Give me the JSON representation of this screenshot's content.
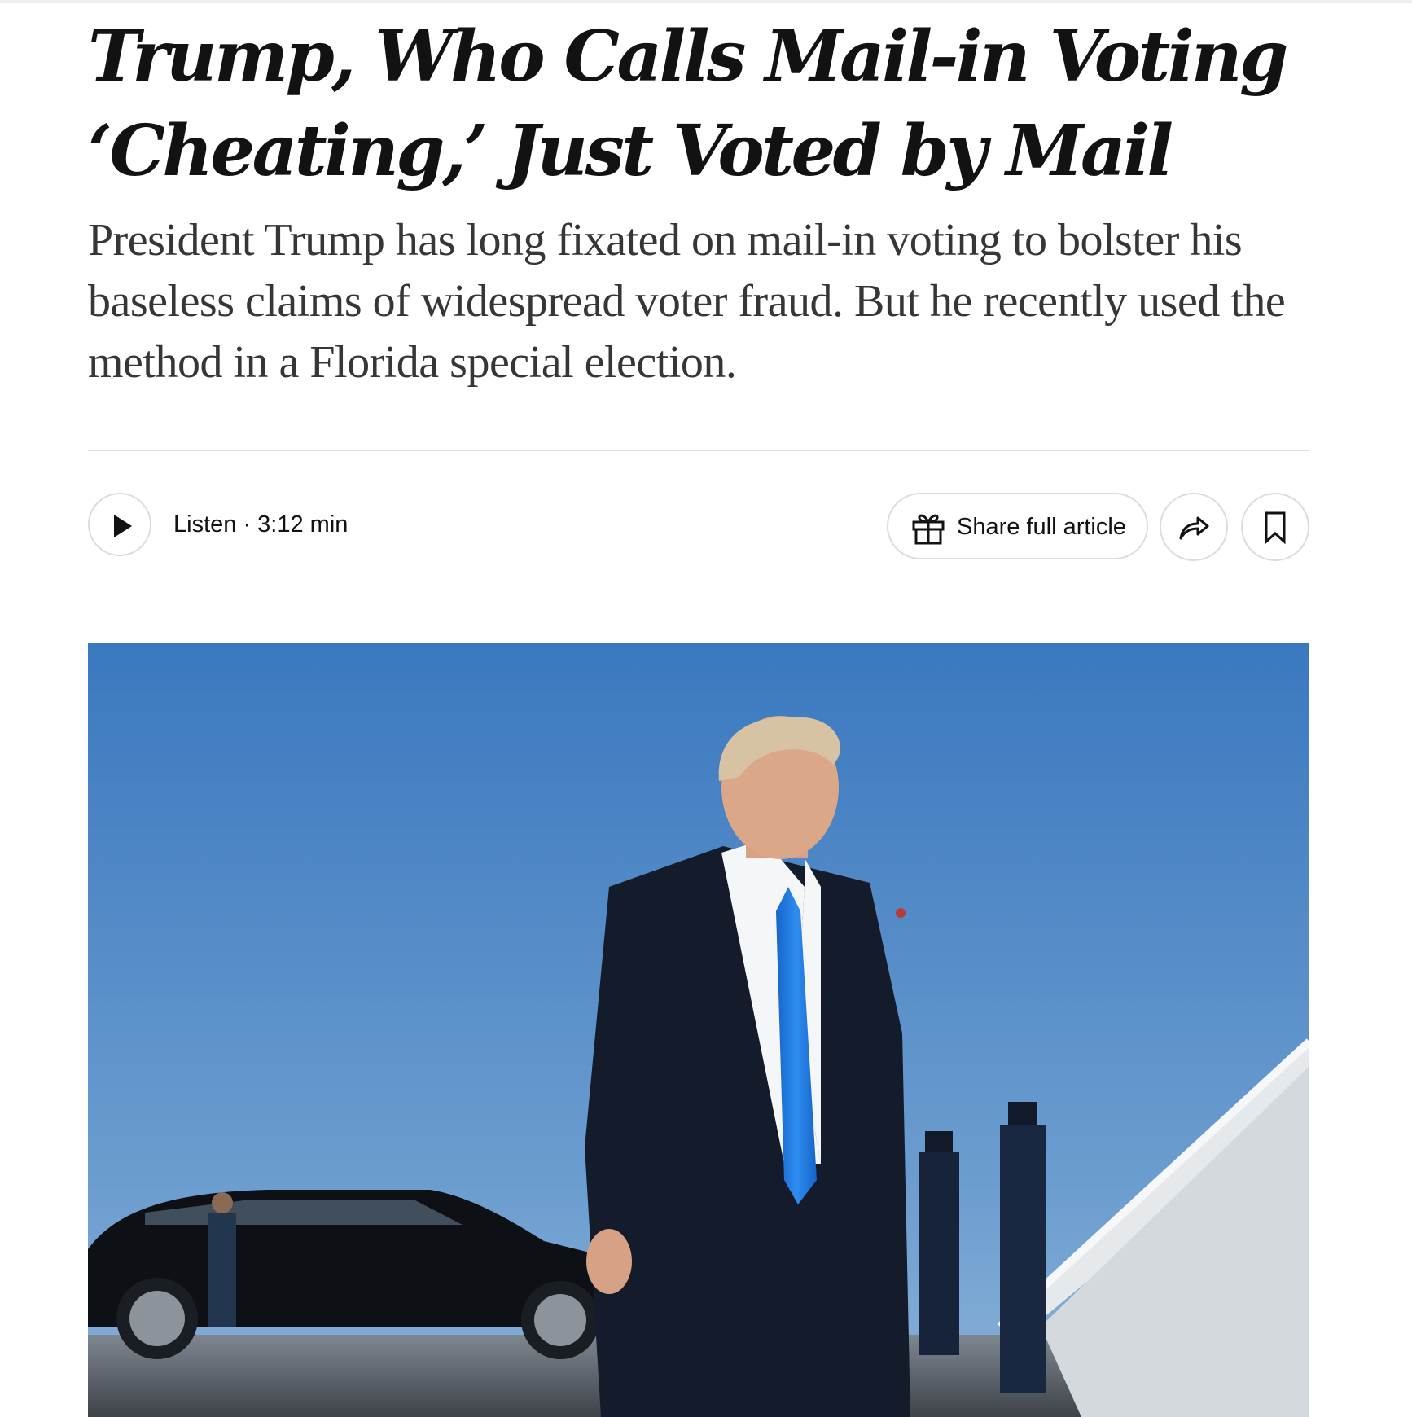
{
  "article": {
    "headline": "Trump, Who Calls Mail-in Voting ‘Cheating,’ Just Voted by Mail",
    "summary": "President Trump has long fixated on mail-in voting to bolster his baseless claims of widespread voter fraud. But he recently used the method in a Florida special election."
  },
  "toolbar": {
    "listen_label": "Listen · 3:12 min",
    "share_label": "Share full article",
    "icons": {
      "play": "play-icon",
      "gift": "gift-icon",
      "share": "share-arrow-icon",
      "bookmark": "bookmark-icon"
    }
  },
  "photo": {
    "subject": "lead-photo"
  },
  "colors": {
    "text": "#121212",
    "summary_text": "#363636",
    "border": "#dcdcdc",
    "sky_top": "#3a78bf",
    "sky_bottom": "#74a3cf",
    "tie": "#1f7be0"
  }
}
